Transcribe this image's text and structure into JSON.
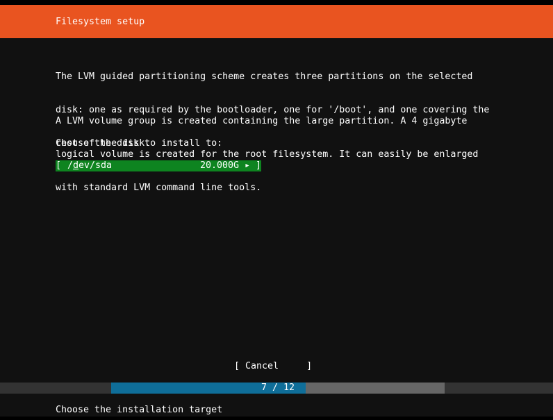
{
  "header": {
    "title": "Filesystem setup"
  },
  "body": {
    "paragraph1": [
      "The LVM guided partitioning scheme creates three partitions on the selected",
      "disk: one as required by the bootloader, one for '/boot', and one covering the",
      "rest of the disk."
    ],
    "paragraph2": [
      "A LVM volume group is created containing the large partition. A 4 gigabyte",
      "logical volume is created for the root filesystem. It can easily be enlarged",
      "with standard LVM command line tools."
    ],
    "prompt": "Choose the disk to install to:"
  },
  "disk_list": [
    {
      "open_bracket": "[",
      "path_prefix": "/",
      "path_cursor_char": "d",
      "path_rest": "ev/sda",
      "size": "20.000G",
      "arrow": "▸",
      "close_bracket": "]"
    }
  ],
  "buttons": {
    "cancel_label": "[ Cancel     ]"
  },
  "progress": {
    "current": 7,
    "total": 12,
    "text": "7 / 12"
  },
  "status": {
    "text": "Choose the installation target"
  },
  "colors": {
    "header_bg": "#e95420",
    "main_bg": "#111111",
    "selected_row_bg": "#0e8420",
    "progress_fill": "#0f6e99",
    "progress_track": "#666666"
  }
}
